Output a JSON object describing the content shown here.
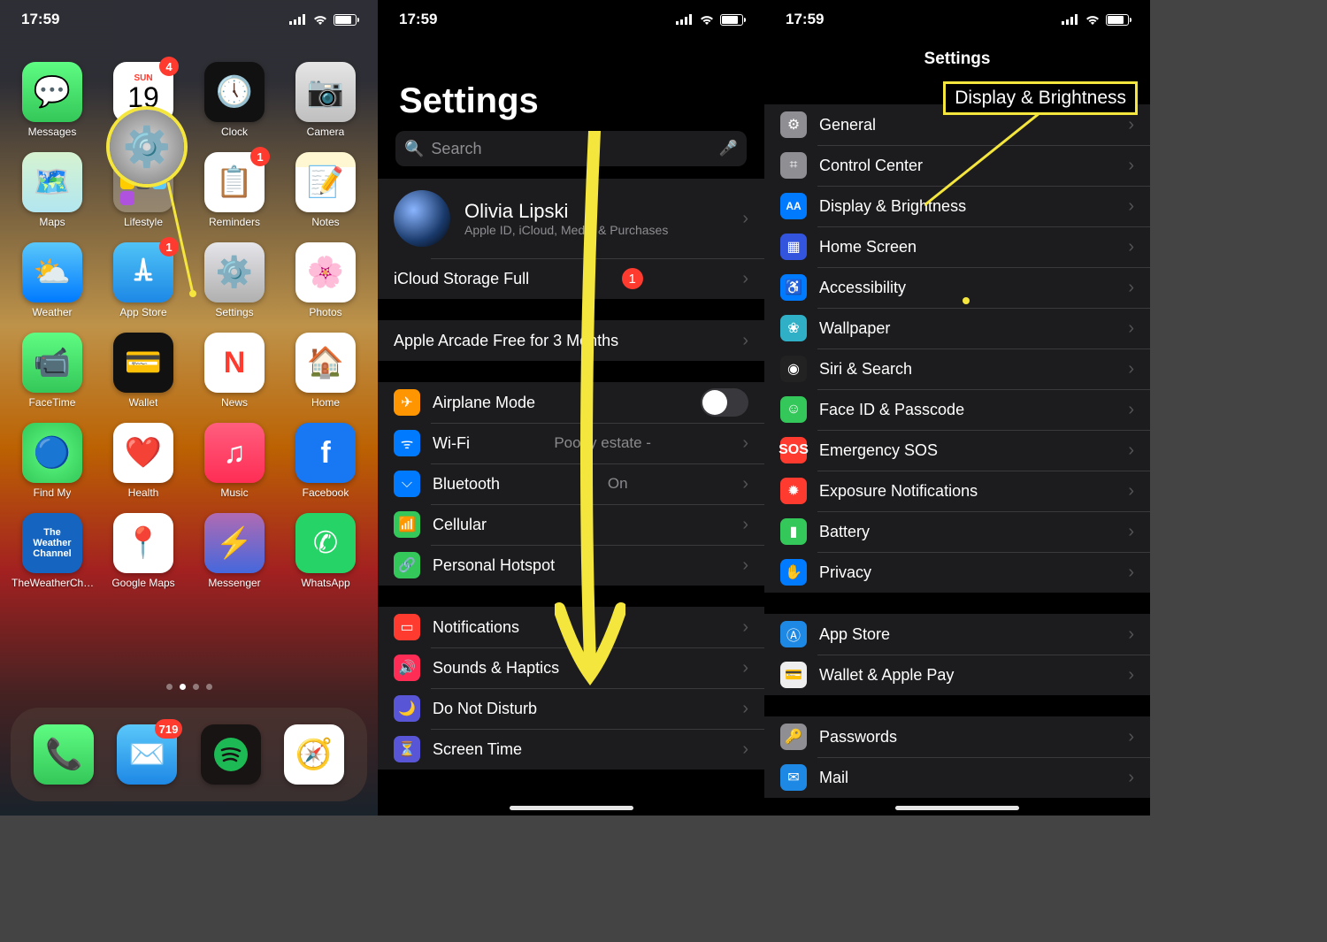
{
  "statusbar": {
    "time": "17:59"
  },
  "home": {
    "calendar": {
      "weekday": "SUN",
      "day": "19",
      "badge": "4"
    },
    "apps": {
      "messages": "Messages",
      "calendar": "Calendar",
      "clock": "Clock",
      "camera": "Camera",
      "maps": "Maps",
      "lifestyle": "Lifestyle",
      "reminders": "Reminders",
      "notes": "Notes",
      "weather": "Weather",
      "appstore": "App Store",
      "settings": "Settings",
      "photos": "Photos",
      "facetime": "FaceTime",
      "wallet": "Wallet",
      "news": "News",
      "homeapp": "Home",
      "findmy": "Find My",
      "health": "Health",
      "music": "Music",
      "facebook": "Facebook",
      "twc": "TheWeatherCh…",
      "gmaps": "Google Maps",
      "messenger": "Messenger",
      "whatsapp": "WhatsApp"
    },
    "badges": {
      "reminders": "1",
      "appstore": "1",
      "mail": "719"
    },
    "twc_text": "The Weather Channel"
  },
  "settings": {
    "title": "Settings",
    "search_placeholder": "Search",
    "profile": {
      "name": "Olivia Lipski",
      "sub": "Apple ID, iCloud, Media & Purchases"
    },
    "storage": {
      "label": "iCloud Storage Full",
      "badge": "1"
    },
    "arcade": "Apple Arcade Free for 3 Months",
    "rows": {
      "airplane": "Airplane Mode",
      "wifi": "Wi-Fi",
      "wifi_detail": "Poopy estate -",
      "bt": "Bluetooth",
      "bt_detail": "On",
      "cell": "Cellular",
      "hot": "Personal Hotspot",
      "notif": "Notifications",
      "sounds": "Sounds & Haptics",
      "dnd": "Do Not Disturb",
      "screentime": "Screen Time"
    }
  },
  "settings3": {
    "header": "Settings",
    "callout": "Display & Brightness",
    "rows": {
      "general": "General",
      "cc": "Control Center",
      "display": "Display & Brightness",
      "homescreen": "Home Screen",
      "access": "Accessibility",
      "wall": "Wallpaper",
      "siri": "Siri & Search",
      "faceid": "Face ID & Passcode",
      "sos": "Emergency SOS",
      "exp": "Exposure Notifications",
      "batt": "Battery",
      "priv": "Privacy",
      "appstore": "App Store",
      "walletpay": "Wallet & Apple Pay",
      "pass": "Passwords",
      "mail": "Mail"
    },
    "sos_icon": "SOS"
  }
}
